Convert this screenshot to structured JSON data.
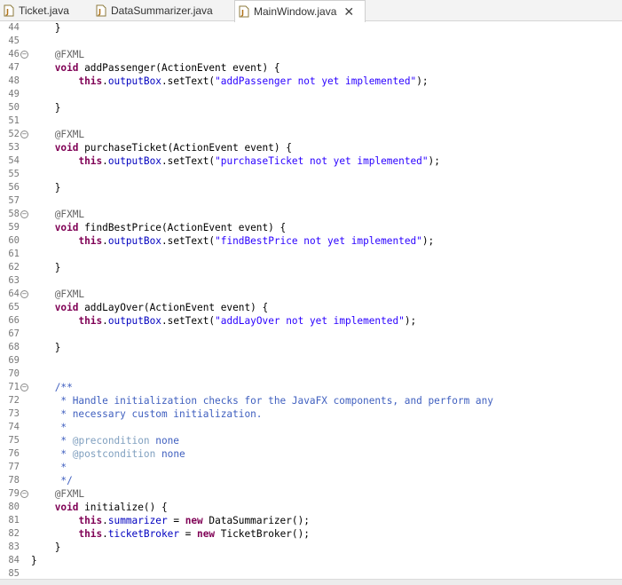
{
  "tabs": [
    {
      "label": "Ticket.java",
      "active": false
    },
    {
      "label": "DataSummarizer.java",
      "active": false
    },
    {
      "label": "MainWindow.java",
      "active": true
    }
  ],
  "tab_close_glyph": "✕",
  "code_lines": [
    {
      "n": "44",
      "t": "    }",
      "fold": false
    },
    {
      "n": "45",
      "t": "",
      "fold": false
    },
    {
      "n": "46",
      "t": "    @FXML",
      "fold": true
    },
    {
      "n": "47",
      "t": "    void addPassenger(ActionEvent event) {",
      "fold": false
    },
    {
      "n": "48",
      "t": "        this.outputBox.setText(\"addPassenger not yet implemented\");",
      "fold": false
    },
    {
      "n": "49",
      "t": "",
      "fold": false
    },
    {
      "n": "50",
      "t": "    }",
      "fold": false
    },
    {
      "n": "51",
      "t": "",
      "fold": false
    },
    {
      "n": "52",
      "t": "    @FXML",
      "fold": true
    },
    {
      "n": "53",
      "t": "    void purchaseTicket(ActionEvent event) {",
      "fold": false
    },
    {
      "n": "54",
      "t": "        this.outputBox.setText(\"purchaseTicket not yet implemented\");",
      "fold": false
    },
    {
      "n": "55",
      "t": "",
      "fold": false
    },
    {
      "n": "56",
      "t": "    }",
      "fold": false
    },
    {
      "n": "57",
      "t": "",
      "fold": false
    },
    {
      "n": "58",
      "t": "    @FXML",
      "fold": true
    },
    {
      "n": "59",
      "t": "    void findBestPrice(ActionEvent event) {",
      "fold": false
    },
    {
      "n": "60",
      "t": "        this.outputBox.setText(\"findBestPrice not yet implemented\");",
      "fold": false
    },
    {
      "n": "61",
      "t": "",
      "fold": false
    },
    {
      "n": "62",
      "t": "    }",
      "fold": false
    },
    {
      "n": "63",
      "t": "",
      "fold": false
    },
    {
      "n": "64",
      "t": "    @FXML",
      "fold": true
    },
    {
      "n": "65",
      "t": "    void addLayOver(ActionEvent event) {",
      "fold": false
    },
    {
      "n": "66",
      "t": "        this.outputBox.setText(\"addLayOver not yet implemented\");",
      "fold": false
    },
    {
      "n": "67",
      "t": "",
      "fold": false
    },
    {
      "n": "68",
      "t": "    }",
      "fold": false
    },
    {
      "n": "69",
      "t": "",
      "fold": false
    },
    {
      "n": "70",
      "t": "",
      "fold": false
    },
    {
      "n": "71",
      "t": "    /**",
      "fold": true
    },
    {
      "n": "72",
      "t": "     * Handle initialization checks for the JavaFX components, and perform any",
      "fold": false
    },
    {
      "n": "73",
      "t": "     * necessary custom initialization.",
      "fold": false
    },
    {
      "n": "74",
      "t": "     *",
      "fold": false
    },
    {
      "n": "75",
      "t": "     * @precondition none",
      "fold": false
    },
    {
      "n": "76",
      "t": "     * @postcondition none",
      "fold": false
    },
    {
      "n": "77",
      "t": "     *",
      "fold": false
    },
    {
      "n": "78",
      "t": "     */",
      "fold": false
    },
    {
      "n": "79",
      "t": "    @FXML",
      "fold": true
    },
    {
      "n": "80",
      "t": "    void initialize() {",
      "fold": false
    },
    {
      "n": "81",
      "t": "        this.summarizer = new DataSummarizer();",
      "fold": false
    },
    {
      "n": "82",
      "t": "        this.ticketBroker = new TicketBroker();",
      "fold": false
    },
    {
      "n": "83",
      "t": "    }",
      "fold": false
    },
    {
      "n": "84",
      "t": "}",
      "fold": false
    },
    {
      "n": "85",
      "t": "",
      "fold": false
    }
  ],
  "colors": {
    "keyword": "#7f0055",
    "field": "#0000c0",
    "string": "#2a00ff",
    "annotation": "#646464",
    "javadoc": "#3f5fbf",
    "javadoc_tag": "#7f9fbf"
  },
  "icons": {
    "tab_file_icon": "java-file-icon",
    "fold_icon": "fold-collapse-icon"
  }
}
